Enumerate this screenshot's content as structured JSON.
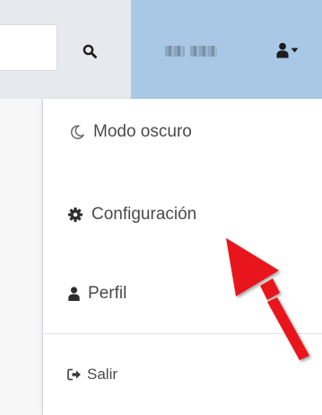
{
  "navbar": {
    "search_icon": "search-icon",
    "user_icon": "user-icon",
    "caret_icon": "caret-down-icon",
    "colors": {
      "navbar_bg": "#e6e9ed",
      "user_area_bg": "#a9c8e6"
    }
  },
  "menu": {
    "items": [
      {
        "label": "Modo oscuro",
        "icon": "moon-icon"
      },
      {
        "label": "Configuración",
        "icon": "gear-icon"
      },
      {
        "label": "Perfil",
        "icon": "user-icon"
      },
      {
        "label": "Salir",
        "icon": "sign-out-icon"
      }
    ]
  },
  "annotation": {
    "arrow_color": "#e8141b",
    "arrow_icon": "red-arrow-icon"
  }
}
